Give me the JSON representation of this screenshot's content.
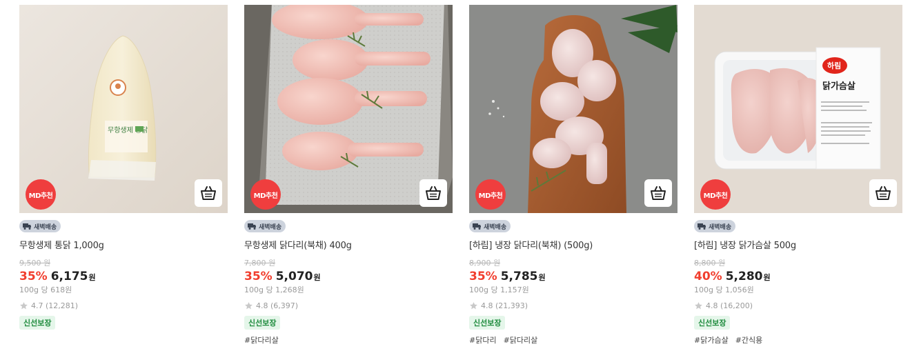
{
  "badges": {
    "md_label": "MD추천",
    "delivery_label": "새벽배송",
    "fresh_label": "신선보장"
  },
  "colors": {
    "discount": "#f13e2e",
    "md_badge": "#ef3e3e",
    "fresh_bg": "#e5f6ea",
    "fresh_text": "#1d8b3c"
  },
  "icons": {
    "cart": "cart-icon",
    "star": "star-icon",
    "delivery": "truck-icon"
  },
  "products": [
    {
      "name": "무항생제 통닭 1,000g",
      "original_price": "9,500 원",
      "discount": "35%",
      "price": "6,175",
      "currency": "원",
      "unit_price": "100g 당 618원",
      "rating": "4.7 (12,281)",
      "tags": []
    },
    {
      "name": "무항생제 닭다리(북채) 400g",
      "original_price": "7,800 원",
      "discount": "35%",
      "price": "5,070",
      "currency": "원",
      "unit_price": "100g 당 1,268원",
      "rating": "4.8 (6,397)",
      "tags": [
        "#닭다리살"
      ]
    },
    {
      "name": "[하림] 냉장 닭다리(북채) (500g)",
      "original_price": "8,900 원",
      "discount": "35%",
      "price": "5,785",
      "currency": "원",
      "unit_price": "100g 당 1,157원",
      "rating": "4.8 (21,393)",
      "tags": [
        "#닭다리",
        "#닭다리살"
      ]
    },
    {
      "name": "[하림] 냉장 닭가슴살 500g",
      "original_price": "8,800 원",
      "discount": "40%",
      "price": "5,280",
      "currency": "원",
      "unit_price": "100g 당 1,056원",
      "rating": "4.8 (16,200)",
      "tags": [
        "#닭가슴살",
        "#간식용"
      ]
    }
  ],
  "image_labels": {
    "whole_chicken_package": "무항생제 통닭",
    "harim_brand": "하림",
    "breast_package": "닭가슴살"
  }
}
